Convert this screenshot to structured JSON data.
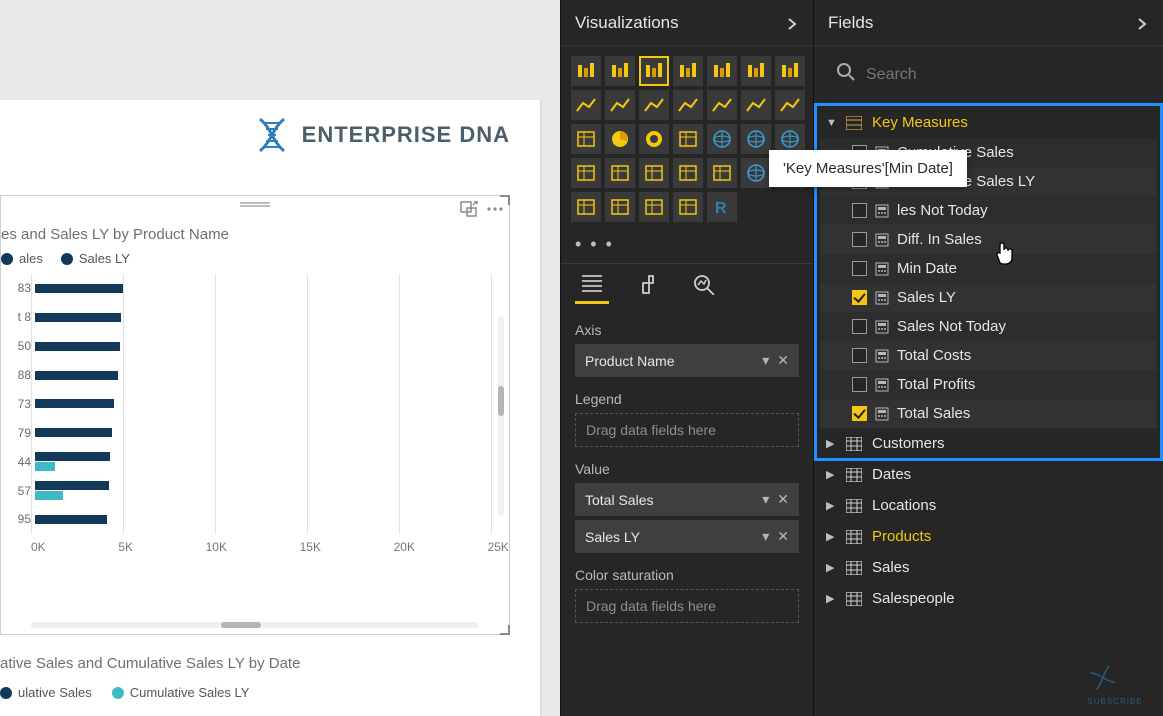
{
  "brand": {
    "text": "ENTERPRISE DNA"
  },
  "chart1": {
    "title": "es and Sales LY by Product Name",
    "legend": [
      {
        "label": "ales",
        "color": "#13395a"
      },
      {
        "label": "Sales LY",
        "color": "#13395a"
      }
    ]
  },
  "chart2": {
    "title": "ative Sales and Cumulative Sales LY by Date",
    "legend": [
      {
        "label": "ulative Sales",
        "color": "#13395a"
      },
      {
        "label": "Cumulative Sales LY",
        "color": "#3fb9c4"
      }
    ]
  },
  "chart_data": {
    "type": "bar",
    "title": "es and Sales LY by Product Name",
    "xlabel": "",
    "ylabel": "",
    "x_ticks": [
      "0K",
      "5K",
      "10K",
      "15K",
      "20K",
      "25K"
    ],
    "ylim": [
      0,
      25000
    ],
    "categories": [
      "83",
      "t 8",
      "50",
      "88",
      "73",
      "79",
      "44",
      "57",
      "95"
    ],
    "series": [
      {
        "name": "ales",
        "values": [
          4800,
          4700,
          4600,
          4500,
          4300,
          4200,
          4100,
          4000,
          3900
        ]
      },
      {
        "name": "Sales LY",
        "values": [
          0,
          0,
          0,
          0,
          0,
          0,
          1100,
          1500,
          0
        ]
      }
    ]
  },
  "viz": {
    "header": "Visualizations",
    "more": "• • •",
    "wells": {
      "axis_label": "Axis",
      "axis_value": "Product Name",
      "legend_label": "Legend",
      "legend_placeholder": "Drag data fields here",
      "value_label": "Value",
      "value_items": [
        "Total Sales",
        "Sales LY"
      ],
      "colorsat_label": "Color saturation",
      "colorsat_placeholder": "Drag data fields here"
    }
  },
  "fields": {
    "header": "Fields",
    "search_placeholder": "Search",
    "tooltip": "'Key Measures'[Min Date]",
    "key_measures": {
      "name": "Key Measures",
      "items": [
        {
          "name": "Cumulative Sales",
          "checked": false
        },
        {
          "name": "Cumulative Sales LY",
          "checked": false
        },
        {
          "name": "les Not Today",
          "checked": false,
          "truncated": true
        },
        {
          "name": "Diff. In Sales",
          "checked": false
        },
        {
          "name": "Min Date",
          "checked": false
        },
        {
          "name": "Sales LY",
          "checked": true
        },
        {
          "name": "Sales Not Today",
          "checked": false
        },
        {
          "name": "Total Costs",
          "checked": false
        },
        {
          "name": "Total Profits",
          "checked": false
        },
        {
          "name": "Total Sales",
          "checked": true
        }
      ]
    },
    "tables": [
      {
        "name": "Customers"
      },
      {
        "name": "Dates"
      },
      {
        "name": "Locations"
      },
      {
        "name": "Products",
        "highlight": true
      },
      {
        "name": "Sales"
      },
      {
        "name": "Salespeople"
      }
    ]
  },
  "watermark": "SUBSCRIBE"
}
